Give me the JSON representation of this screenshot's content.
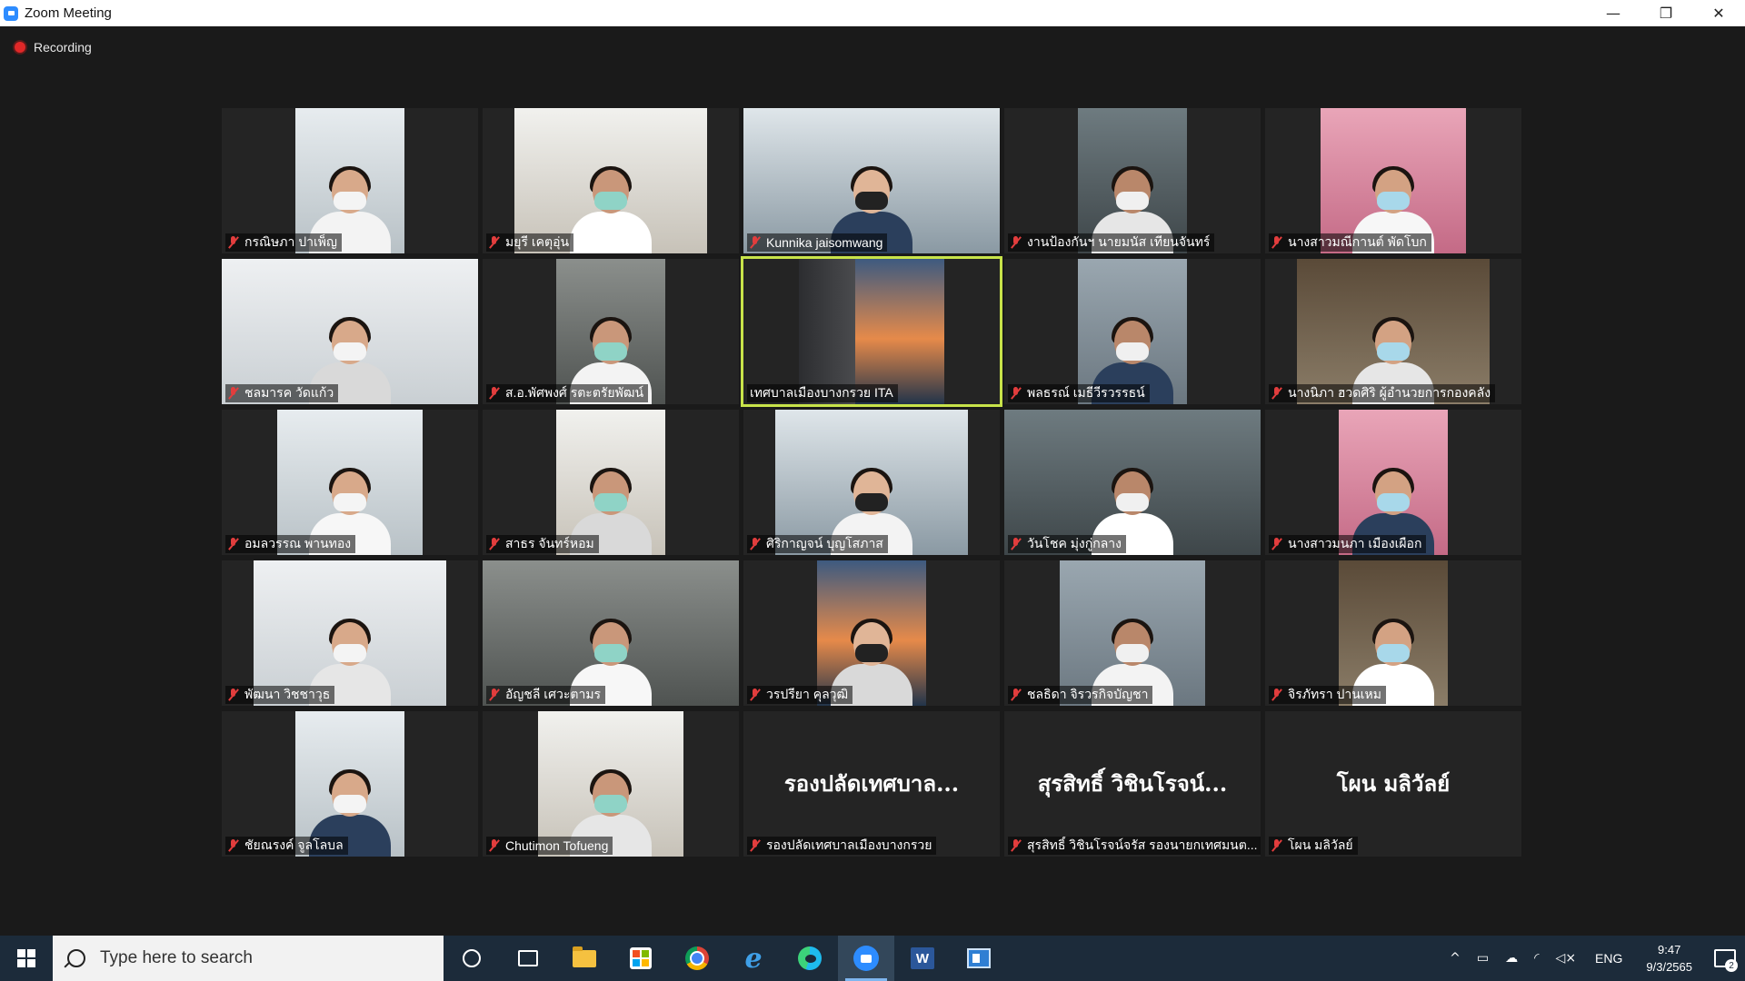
{
  "window": {
    "title": "Zoom Meeting",
    "controls": {
      "minimize": "—",
      "restore": "❐",
      "close": "✕"
    }
  },
  "recording": {
    "label": "Recording",
    "color": "#e02828"
  },
  "speaker_outline_color": "#c8e34a",
  "participants": [
    {
      "name": "กรณิษภา ปาเพ็ญ",
      "video": true,
      "speaking": false
    },
    {
      "name": "มยุรี เคตุอุ่น",
      "video": true,
      "speaking": false
    },
    {
      "name": "Kunnika jaisomwang",
      "video": true,
      "speaking": false
    },
    {
      "name": "งานป้องกันฯ นายมนัส เทียนจันทร์",
      "video": true,
      "speaking": false
    },
    {
      "name": "นางสาวมณีกานต์ พัดโบก",
      "video": true,
      "speaking": false
    },
    {
      "name": "ชลมารค วัดแก้ว",
      "video": true,
      "speaking": false
    },
    {
      "name": "ส.อ.พัศพงศ์ รตะตรัยพัฒน์",
      "video": true,
      "speaking": false
    },
    {
      "name": "เทศบาลเมืองบางกรวย ITA",
      "video": true,
      "speaking": true
    },
    {
      "name": "พลธรณ์ เมธีวีรวรรธน์",
      "video": true,
      "speaking": false
    },
    {
      "name": "นางนิภา ฮวดศิริ ผู้อำนวยการกองคลัง",
      "video": true,
      "speaking": false
    },
    {
      "name": "อมลวรรณ พานทอง",
      "video": true,
      "speaking": false
    },
    {
      "name": "สาธร จันทร์หอม",
      "video": true,
      "speaking": false
    },
    {
      "name": "ศิริกาญจน์ บุญโสภาส",
      "video": true,
      "speaking": false
    },
    {
      "name": "วันโชค มุ่งกู่กลาง",
      "video": true,
      "speaking": false
    },
    {
      "name": "นางสาวมนภา เมืองเผือก",
      "video": true,
      "speaking": false
    },
    {
      "name": "พัฒนา วิชชาวุธ",
      "video": true,
      "speaking": false
    },
    {
      "name": "อัญชลี เศวะตามร",
      "video": true,
      "speaking": false
    },
    {
      "name": "วรปรียา คุลวุฒิ",
      "video": true,
      "speaking": false
    },
    {
      "name": "ชลธิดา จิรวรกิจบัญชา",
      "video": true,
      "speaking": false
    },
    {
      "name": "จิรภัทรา ปานเหม",
      "video": true,
      "speaking": false
    },
    {
      "name": "ชัยณรงค์ จูลโลบล",
      "video": true,
      "speaking": false
    },
    {
      "name": "Chutimon Tofueng",
      "video": true,
      "speaking": false
    },
    {
      "name": "รองปลัดเทศบาลเมืองบางกรวย",
      "display_name": "รองปลัดเทศบาล...",
      "video": false,
      "speaking": false
    },
    {
      "name": "สุรสิทธิ์ วิชินโรจน์จรัส รองนายกเทศมนต...",
      "display_name": "สุรสิทธิ์ วิชินโรจน์...",
      "video": false,
      "speaking": false
    },
    {
      "name": "โผน มลิวัลย์",
      "display_name": "โผน มลิวัลย์",
      "video": false,
      "speaking": false
    }
  ],
  "taskbar": {
    "search_placeholder": "Type here to search",
    "apps": [
      {
        "name": "cortana-icon"
      },
      {
        "name": "task-view-icon"
      },
      {
        "name": "file-explorer-icon"
      },
      {
        "name": "microsoft-store-icon"
      },
      {
        "name": "chrome-icon"
      },
      {
        "name": "internet-explorer-icon"
      },
      {
        "name": "edge-icon"
      },
      {
        "name": "zoom-icon",
        "active": true
      },
      {
        "name": "word-icon"
      },
      {
        "name": "app-window-icon"
      }
    ],
    "tray": {
      "chevron": "^",
      "language": "ENG",
      "time": "9:47",
      "date": "9/3/2565",
      "notification_count": "2"
    }
  }
}
